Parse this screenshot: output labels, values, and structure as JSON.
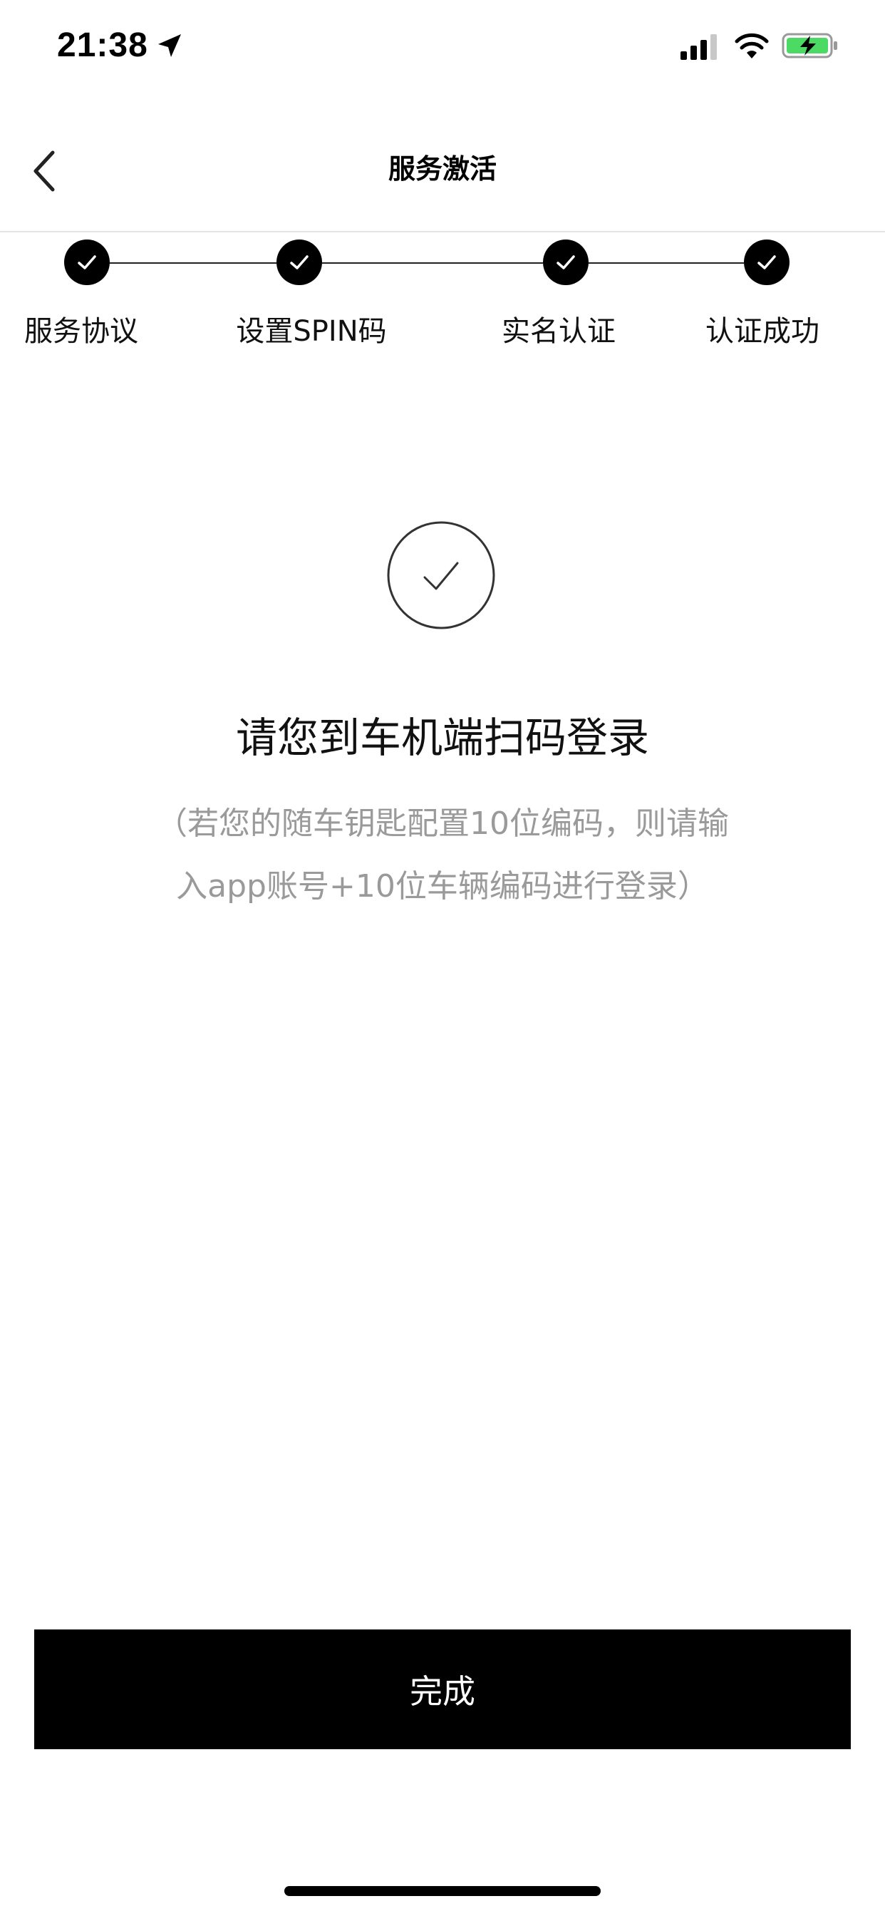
{
  "status_bar": {
    "time": "21:38",
    "icons": [
      "location-arrow-icon",
      "cellular-signal-icon",
      "wifi-icon",
      "battery-charging-icon"
    ],
    "battery_color": "#4cd964"
  },
  "nav": {
    "title": "服务激活",
    "back_icon": "chevron-left-icon"
  },
  "steps": [
    {
      "label": "服务协议",
      "done": true
    },
    {
      "label": "设置SPIN码",
      "done": true
    },
    {
      "label": "实名认证",
      "done": true
    },
    {
      "label": "认证成功",
      "done": true
    }
  ],
  "main": {
    "icon": "check-circle-icon",
    "title": "请您到车机端扫码登录",
    "subtitle_line1": "（若您的随车钥匙配置10位编码，则请输",
    "subtitle_line2": "入app账号+10位车辆编码进行登录）"
  },
  "footer": {
    "done_label": "完成"
  },
  "colors": {
    "primary": "#000000",
    "background": "#ffffff",
    "muted_text": "#9a9a9a"
  }
}
